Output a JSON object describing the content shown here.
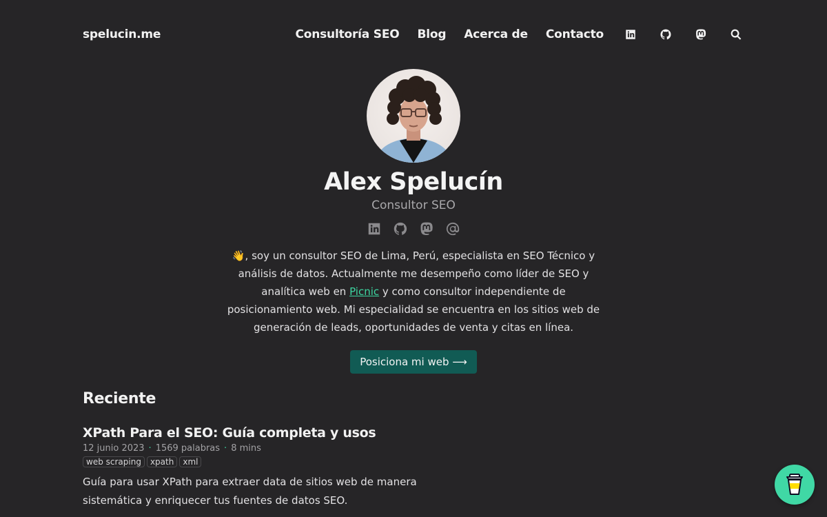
{
  "site": {
    "brand": "spelucin.me"
  },
  "nav": {
    "links": [
      "Consultoría SEO",
      "Blog",
      "Acerca de",
      "Contacto"
    ],
    "icons": [
      "linkedin-icon",
      "github-icon",
      "mastodon-icon",
      "search-icon"
    ]
  },
  "profile": {
    "name": "Alex Spelucín",
    "role": "Consultor SEO",
    "social_icons": [
      "linkedin-icon",
      "github-icon",
      "mastodon-icon",
      "at-icon"
    ],
    "bio_emoji": "👋",
    "bio_before_link": ", soy un consultor SEO de Lima, Perú, especialista en SEO Técnico y análisis de datos. Actualmente me desempeño como líder de SEO y analítica web en ",
    "bio_link": "Picnic",
    "bio_after_link": " y como consultor independiente de posicionamiento web. Mi especialidad se encuentra en los sitios web de generación de leads, oportunidades de venta y citas en línea.",
    "cta": "Posiciona mi web ⟶"
  },
  "recent": {
    "heading": "Reciente",
    "posts": [
      {
        "title": "XPath Para el SEO: Guía completa y usos",
        "date": "12 junio 2023",
        "words": "1569 palabras",
        "read_time": "8 mins",
        "tags": [
          "web scraping",
          "xpath",
          "xml"
        ],
        "excerpt": "Guía para usar XPath para extraer data de sitios web de manera sistemática y enriquecer tus fuentes de datos SEO."
      }
    ]
  },
  "colors": {
    "background": "#262527",
    "accent": "#3dd6a1",
    "cta_bg": "#115b54",
    "bmc_bg": "#40d8a5"
  },
  "floating_button": {
    "icon": "coffee-cup-icon"
  }
}
